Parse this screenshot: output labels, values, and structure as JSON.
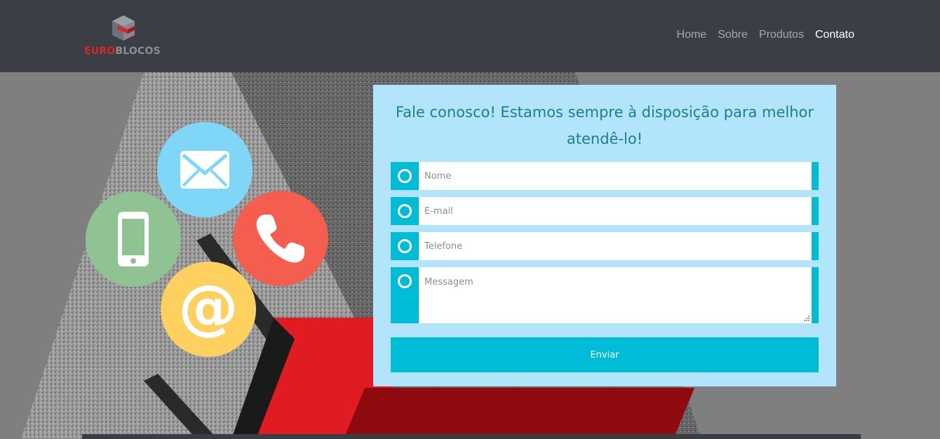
{
  "header": {
    "logo": {
      "part1": "EURO",
      "part2": "BLOCOS"
    },
    "nav": [
      {
        "label": "Home",
        "active": false
      },
      {
        "label": "Sobre",
        "active": false
      },
      {
        "label": "Produtos",
        "active": false
      },
      {
        "label": "Contato",
        "active": true
      }
    ]
  },
  "icons": [
    "envelope-icon",
    "mobile-phone-icon",
    "phone-handset-icon",
    "at-sign-icon"
  ],
  "contact_form": {
    "title": "Fale conosco! Estamos sempre à disposição para melhor atendê-lo!",
    "fields": {
      "nome": {
        "placeholder": "Nome"
      },
      "email": {
        "placeholder": "E-mail"
      },
      "telefone": {
        "placeholder": "Telefone"
      },
      "mensagem": {
        "placeholder": "Messagem"
      }
    },
    "submit_label": "Enviar",
    "at_symbol": "@"
  },
  "colors": {
    "header_bg": "#3b3e45",
    "page_bg": "#7f7f7f",
    "panel_bg": "#b2e5fb",
    "accent": "#00bcd7",
    "title_text": "#1a7f8f",
    "brand_red": "#d9252b"
  }
}
